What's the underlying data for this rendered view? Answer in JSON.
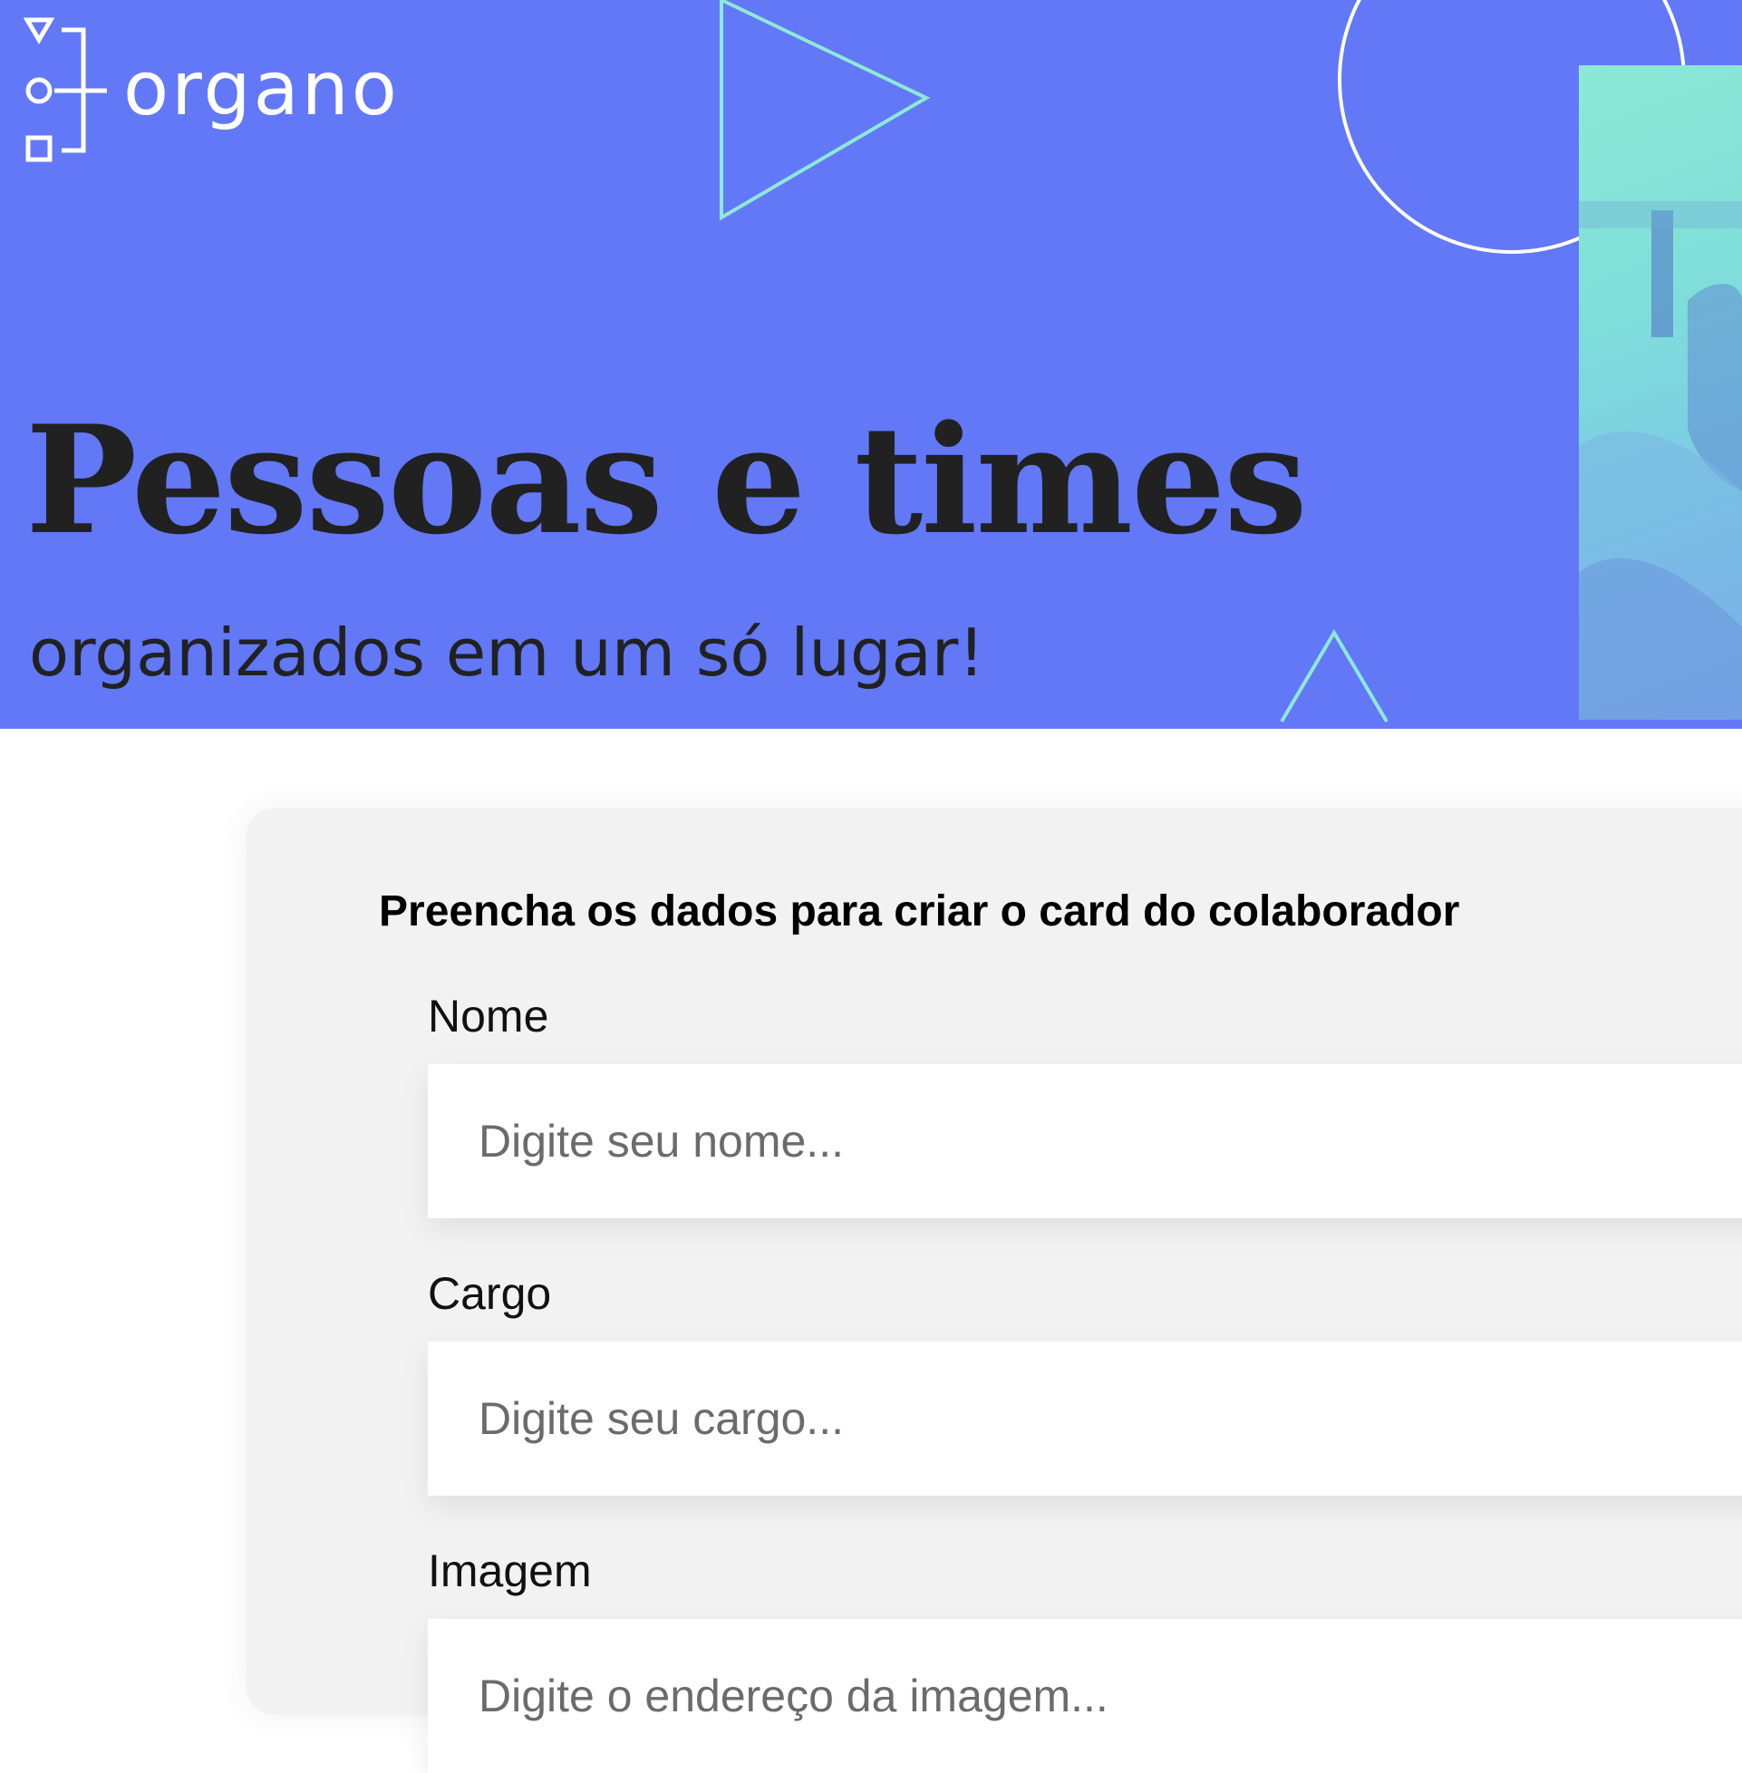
{
  "brand": {
    "name": "organo",
    "logo_icon": "organo-logo-icon"
  },
  "hero": {
    "title": "Pessoas e times",
    "subtitle": "organizados em um só lugar!",
    "decorations": [
      "triangle-outline-icon",
      "circle-outline-icon",
      "triangle-small-icon"
    ]
  },
  "form": {
    "heading": "Preencha os dados para criar o card do colaborador",
    "fields": [
      {
        "label": "Nome",
        "placeholder": "Digite seu nome..."
      },
      {
        "label": "Cargo",
        "placeholder": "Digite seu cargo..."
      },
      {
        "label": "Imagem",
        "placeholder": "Digite o endereço da imagem..."
      }
    ]
  },
  "colors": {
    "banner": "#6278F7",
    "accent_mint": "#8DE9D6",
    "text_dark": "#212121",
    "card_bg": "#F2F2F2"
  }
}
